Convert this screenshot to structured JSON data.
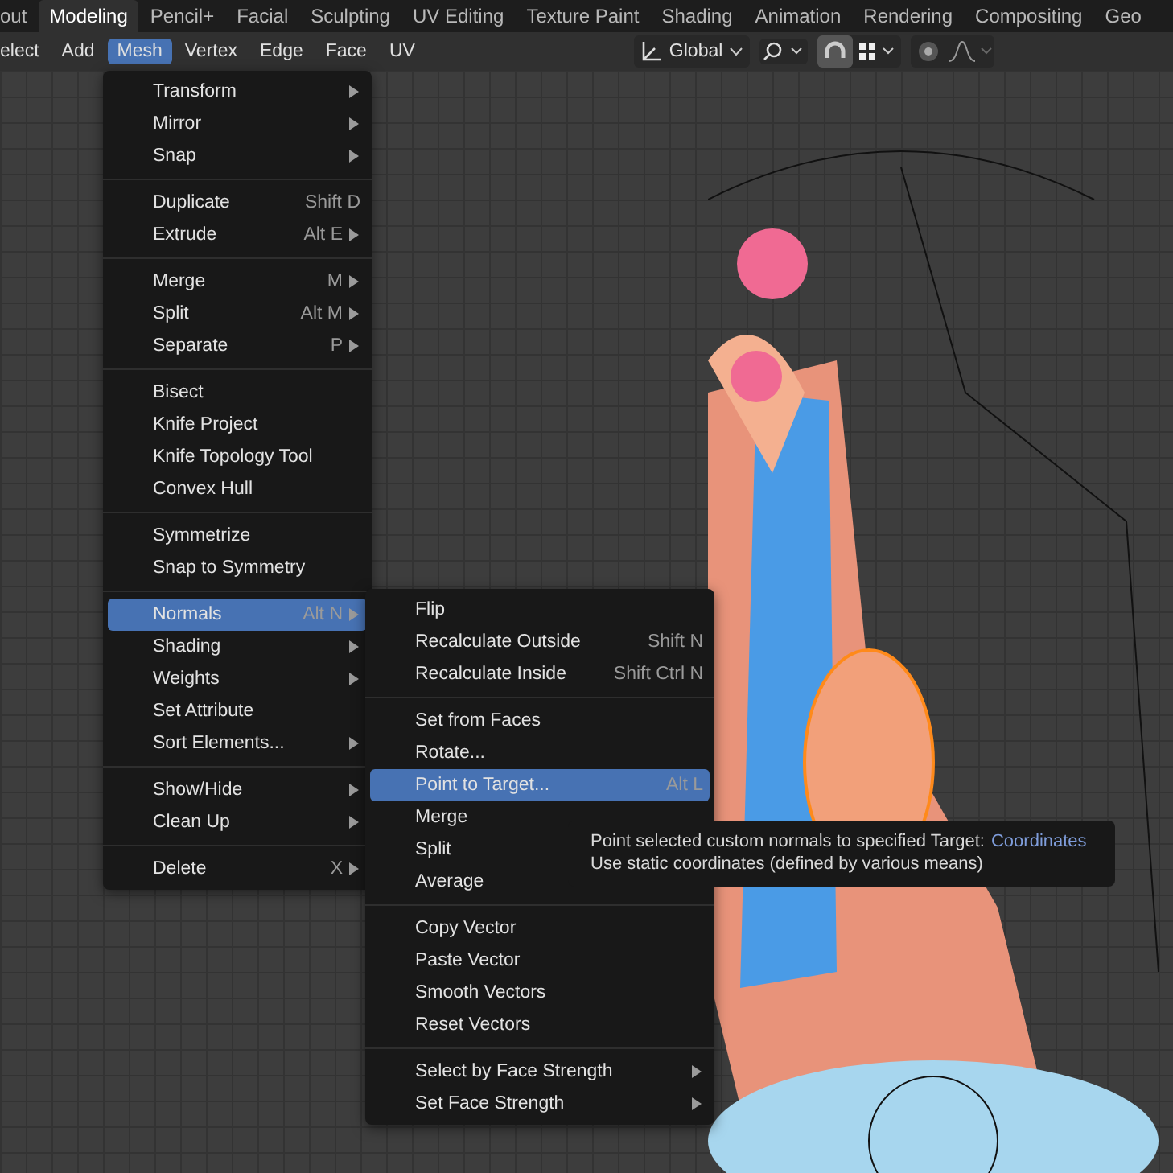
{
  "workspace_tabs": [
    {
      "label": "out",
      "selected": false
    },
    {
      "label": "Modeling",
      "selected": true
    },
    {
      "label": "Pencil+",
      "selected": false
    },
    {
      "label": "Facial",
      "selected": false
    },
    {
      "label": "Sculpting",
      "selected": false
    },
    {
      "label": "UV Editing",
      "selected": false
    },
    {
      "label": "Texture Paint",
      "selected": false
    },
    {
      "label": "Shading",
      "selected": false
    },
    {
      "label": "Animation",
      "selected": false
    },
    {
      "label": "Rendering",
      "selected": false
    },
    {
      "label": "Compositing",
      "selected": false
    },
    {
      "label": "Geo",
      "selected": false
    }
  ],
  "header_menus": [
    {
      "label": "elect",
      "selected": false
    },
    {
      "label": "Add",
      "selected": false
    },
    {
      "label": "Mesh",
      "selected": true
    },
    {
      "label": "Vertex",
      "selected": false
    },
    {
      "label": "Edge",
      "selected": false
    },
    {
      "label": "Face",
      "selected": false
    },
    {
      "label": "UV",
      "selected": false
    }
  ],
  "transform_orientation": "Global",
  "snap": {
    "on": true
  },
  "mesh_menu": {
    "sections": [
      [
        {
          "label": "Transform",
          "submenu": true,
          "selected": false
        },
        {
          "label": "Mirror",
          "submenu": true,
          "selected": false
        },
        {
          "label": "Snap",
          "submenu": true,
          "selected": false
        }
      ],
      [
        {
          "label": "Duplicate",
          "shortcut": "Shift D",
          "submenu": false,
          "selected": false
        },
        {
          "label": "Extrude",
          "shortcut": "Alt E",
          "submenu": true,
          "selected": false
        }
      ],
      [
        {
          "label": "Merge",
          "shortcut": "M",
          "submenu": true,
          "selected": false
        },
        {
          "label": "Split",
          "shortcut": "Alt M",
          "submenu": true,
          "selected": false
        },
        {
          "label": "Separate",
          "shortcut": "P",
          "submenu": true,
          "selected": false
        }
      ],
      [
        {
          "label": "Bisect",
          "submenu": false,
          "selected": false
        },
        {
          "label": "Knife Project",
          "submenu": false,
          "selected": false
        },
        {
          "label": "Knife Topology Tool",
          "submenu": false,
          "selected": false
        },
        {
          "label": "Convex Hull",
          "submenu": false,
          "selected": false
        }
      ],
      [
        {
          "label": "Symmetrize",
          "submenu": false,
          "selected": false
        },
        {
          "label": "Snap to Symmetry",
          "submenu": false,
          "selected": false
        }
      ],
      [
        {
          "label": "Normals",
          "shortcut": "Alt N",
          "submenu": true,
          "selected": true
        },
        {
          "label": "Shading",
          "submenu": true,
          "selected": false
        },
        {
          "label": "Weights",
          "submenu": true,
          "selected": false
        },
        {
          "label": "Set Attribute",
          "submenu": false,
          "selected": false
        },
        {
          "label": "Sort Elements...",
          "submenu": true,
          "selected": false
        }
      ],
      [
        {
          "label": "Show/Hide",
          "submenu": true,
          "selected": false
        },
        {
          "label": "Clean Up",
          "submenu": true,
          "selected": false
        }
      ],
      [
        {
          "label": "Delete",
          "shortcut": "X",
          "submenu": true,
          "selected": false
        }
      ]
    ]
  },
  "normals_menu": {
    "sections": [
      [
        {
          "label": "Flip",
          "submenu": false,
          "selected": false
        },
        {
          "label": "Recalculate Outside",
          "shortcut": "Shift N",
          "submenu": false,
          "selected": false
        },
        {
          "label": "Recalculate Inside",
          "shortcut": "Shift Ctrl N",
          "submenu": false,
          "selected": false
        }
      ],
      [
        {
          "label": "Set from Faces",
          "submenu": false,
          "selected": false
        },
        {
          "label": "Rotate...",
          "submenu": false,
          "selected": false
        },
        {
          "label": "Point to Target...",
          "shortcut": "Alt L",
          "submenu": false,
          "selected": true
        },
        {
          "label": "Merge",
          "submenu": false,
          "selected": false
        },
        {
          "label": "Split",
          "submenu": false,
          "selected": false
        },
        {
          "label": "Average",
          "submenu": false,
          "selected": false
        }
      ],
      [
        {
          "label": "Copy Vector",
          "submenu": false,
          "selected": false
        },
        {
          "label": "Paste Vector",
          "submenu": false,
          "selected": false
        },
        {
          "label": "Smooth Vectors",
          "submenu": false,
          "selected": false
        },
        {
          "label": "Reset Vectors",
          "submenu": false,
          "selected": false
        }
      ],
      [
        {
          "label": "Select by Face Strength",
          "submenu": true,
          "selected": false
        },
        {
          "label": "Set Face Strength",
          "submenu": true,
          "selected": false
        }
      ]
    ]
  },
  "tooltip": {
    "text": "Point selected custom normals to specified Target:",
    "value": "Coordinates",
    "detail": "Use static coordinates (defined by various means)"
  }
}
